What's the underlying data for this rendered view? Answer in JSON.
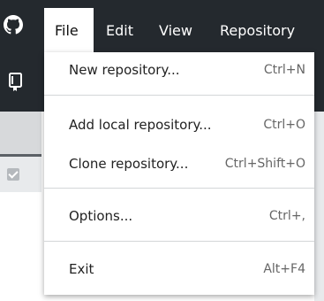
{
  "menubar": {
    "items": [
      {
        "label": "File"
      },
      {
        "label": "Edit"
      },
      {
        "label": "View"
      },
      {
        "label": "Repository"
      }
    ],
    "active": "File"
  },
  "file_menu": {
    "items": [
      {
        "label": "New repository...",
        "shortcut": "Ctrl+N"
      },
      {
        "label": "Add local repository...",
        "shortcut": "Ctrl+O"
      },
      {
        "label": "Clone repository...",
        "shortcut": "Ctrl+Shift+O"
      },
      {
        "label": "Options...",
        "shortcut": "Ctrl+,"
      },
      {
        "label": "Exit",
        "shortcut": "Alt+F4"
      }
    ]
  },
  "colors": {
    "titlebar": "#24292e",
    "menu_bg": "#ffffff",
    "menu_text": "#222222",
    "shortcut_text": "#666666"
  },
  "icons": [
    "github-logo-icon",
    "repository-icon",
    "checkbox-icon"
  ]
}
